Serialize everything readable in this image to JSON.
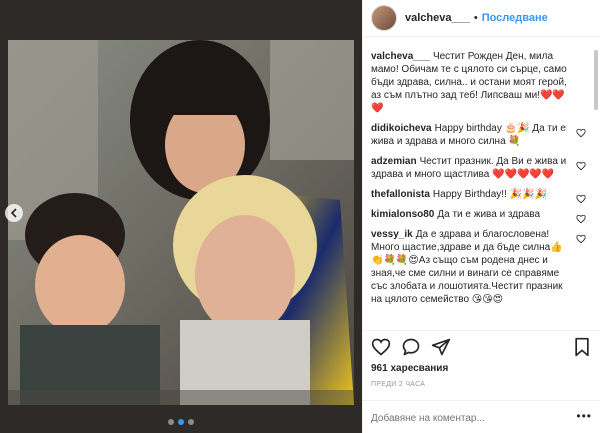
{
  "post": {
    "username": "valcheva___",
    "separator": "•",
    "follow_label": "Последване",
    "likes_text": "961 харесвания",
    "time_text": "ПРЕДИ 2 ЧАСА",
    "add_comment_placeholder": "Добавяне на коментар...",
    "more_icon": "•••"
  },
  "comments": [
    {
      "user": "valcheva___",
      "text": "Честит Рожден Ден, мила мамо! Обичам те с цялото си сърце, само бъди здрава, силна.. и остани моят герой, аз съм плътно зад теб! Липсваш ми!❤️❤️❤️",
      "has_heart": false
    },
    {
      "user": "didikoicheva",
      "text": "Happy birthday 🎂🎉 Да ти е жива и здрава и много силна 💐",
      "has_heart": true
    },
    {
      "user": "adzemian",
      "text": "Честит празник. Да Ви е жива и здрава и много щастлива ❤️❤️❤️❤️❤️",
      "has_heart": true
    },
    {
      "user": "thefallonista",
      "text": "Happy Birthday!! 🎉🎉🎉",
      "has_heart": true
    },
    {
      "user": "kimialonso80",
      "text": "Да ти е жива и здрава",
      "has_heart": true
    },
    {
      "user": "vessy_ik",
      "text": "Да е здрава и благословена! Много щастие,здраве и да бъде силна👍👏💐💐😍Аз също съм родена днес и зная,че сме силни и винаги се справяме със злобата и лошотията.Честит празник на цялото семейство 😘😘😍",
      "has_heart": true
    }
  ],
  "icons": {
    "like": "heart-outline",
    "comment": "speech-bubble",
    "share": "paper-plane",
    "save": "bookmark"
  }
}
